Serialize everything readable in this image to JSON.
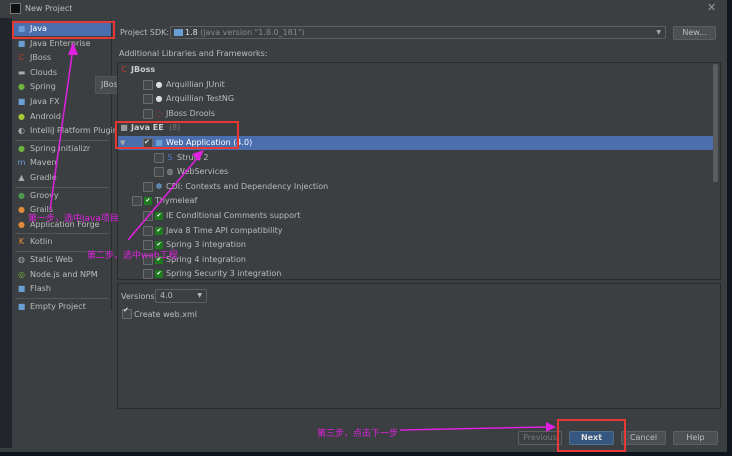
{
  "window": {
    "title": "New Project",
    "close_icon": "close-icon",
    "app_icon": "intellij-icon"
  },
  "sidebar": {
    "items": [
      {
        "label": "Java",
        "icon": "folder-icon",
        "selected": true
      },
      {
        "label": "Java Enterprise",
        "icon": "java-enterprise-icon"
      },
      {
        "label": "JBoss",
        "icon": "jboss-icon"
      },
      {
        "label": "Clouds",
        "icon": "cloud-icon"
      },
      {
        "label": "Spring",
        "icon": "spring-icon"
      },
      {
        "label": "Java FX",
        "icon": "folder-icon"
      },
      {
        "label": "Android",
        "icon": "android-icon"
      },
      {
        "label": "IntelliJ Platform Plugin",
        "icon": "plugin-icon"
      },
      {
        "label": "Spring Initializr",
        "icon": "spring-icon"
      },
      {
        "label": "Maven",
        "icon": "maven-icon"
      },
      {
        "label": "Gradle",
        "icon": "gradle-icon"
      },
      {
        "label": "Groovy",
        "icon": "groovy-icon"
      },
      {
        "label": "Grails",
        "icon": "grails-icon"
      },
      {
        "label": "Application Forge",
        "icon": "grails-icon"
      },
      {
        "label": "Kotlin",
        "icon": "kotlin-icon"
      },
      {
        "label": "Static Web",
        "icon": "globe-icon"
      },
      {
        "label": "Node.js and NPM",
        "icon": "nodejs-icon"
      },
      {
        "label": "Flash",
        "icon": "folder-icon"
      },
      {
        "label": "Empty Project",
        "icon": "folder-icon"
      }
    ]
  },
  "tooltip": "JBoss",
  "sdk": {
    "label": "Project SDK:",
    "value": "1.8",
    "version": "(java version \"1.8.0_181\")",
    "new_button": "New..."
  },
  "frameworks": {
    "label": "Additional Libraries and Frameworks:",
    "rows": [
      {
        "label": "JBoss",
        "type": "group",
        "icon": "jboss-icon"
      },
      {
        "label": "Arquillian JUnit",
        "checked": false,
        "icon": "arquillian-icon"
      },
      {
        "label": "Arquillian TestNG",
        "checked": false,
        "icon": "arquillian-icon"
      },
      {
        "label": "JBoss Drools",
        "checked": false,
        "icon": "drools-icon"
      },
      {
        "label": "Java EE",
        "count": "(8)",
        "type": "group",
        "icon": "javaee-icon"
      },
      {
        "label": "Web Application (4.0)",
        "checked": true,
        "selected": true,
        "icon": "web-icon"
      },
      {
        "label": "Struts 2",
        "checked": false,
        "icon": "struts-icon"
      },
      {
        "label": "WebServices",
        "checked": false,
        "icon": "globe-icon"
      },
      {
        "label": "CDI: Contexts and Dependency Injection",
        "checked": false,
        "icon": "cdi-icon"
      },
      {
        "label": "Thymeleaf",
        "checked": false,
        "icon": "check-green-icon"
      },
      {
        "label": "IE Conditional Comments support",
        "checked": false,
        "icon": "check-green-icon"
      },
      {
        "label": "Java 8 Time API compatibility",
        "checked": false,
        "icon": "check-green-icon"
      },
      {
        "label": "Spring 3 integration",
        "checked": false,
        "icon": "check-green-icon"
      },
      {
        "label": "Spring 4 integration",
        "checked": false,
        "icon": "check-green-icon"
      },
      {
        "label": "Spring Security 3 integration",
        "checked": false,
        "icon": "check-green-icon"
      }
    ]
  },
  "options": {
    "versions_label": "Versions:",
    "version_value": "4.0",
    "create_webxml": "Create web.xml",
    "create_webxml_checked": true
  },
  "buttons": {
    "previous": "Previous",
    "next": "Next",
    "cancel": "Cancel",
    "help": "Help"
  },
  "annotations": {
    "step1": "第一步，选中java项目",
    "step2": "第二步，选中web工程",
    "step3": "第三步，点击下一步",
    "color": "#e020e0",
    "box_color": "#e53935"
  }
}
